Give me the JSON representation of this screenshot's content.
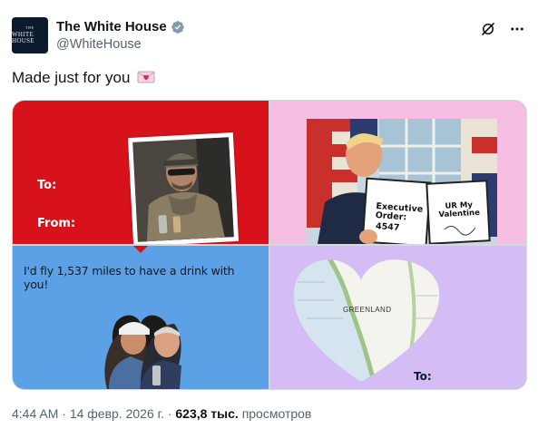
{
  "author": {
    "display_name": "The White House",
    "handle": "@WhiteHouse",
    "avatar_text_top": "THE",
    "avatar_text_main": "WHITE HOUSE",
    "verified": true,
    "verified_color": "#829aab"
  },
  "tweet": {
    "text": "Made just for you",
    "emoji": "love-letter-icon"
  },
  "media": {
    "card1": {
      "to_label": "To:",
      "from_label": "From:",
      "bg_color": "#d8121a"
    },
    "card2": {
      "bg_color": "#f6bfe2",
      "sign_left_title": "Executive Order:",
      "sign_left_number": "4547",
      "sign_right_text": "UR My Valentine"
    },
    "card3": {
      "bg_color": "#5ca1e5",
      "quote": "I'd fly 1,537 miles to have a drink with you!"
    },
    "card4": {
      "bg_color": "#d4bdf4",
      "map_label": "GREENLAND",
      "to_label": "To:"
    }
  },
  "footer": {
    "time": "4:44 AM",
    "date": "14 февр. 2026 г.",
    "views_count": "623,8 тыс.",
    "views_label": "просмотров"
  }
}
